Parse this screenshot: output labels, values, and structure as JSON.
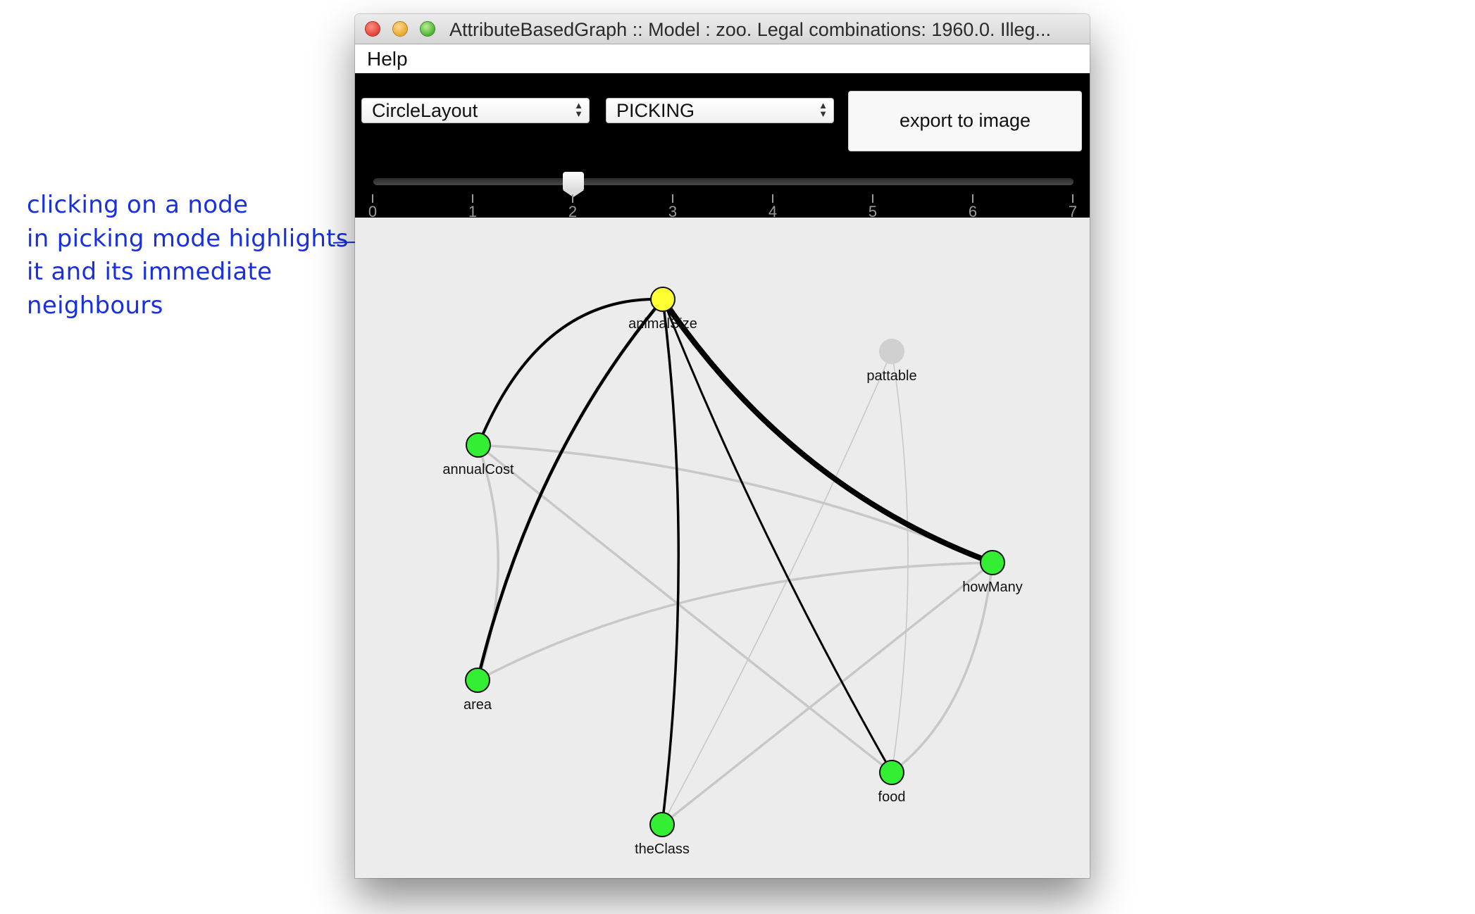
{
  "annotation": {
    "lines": [
      "clicking on a node",
      "in picking mode highlights",
      "it and its immediate",
      "neighbours"
    ]
  },
  "window": {
    "title": "AttributeBasedGraph :: Model : zoo. Legal combinations: 1960.0. Illeg...",
    "menu": [
      "Help"
    ]
  },
  "toolbar": {
    "layout_select": "CircleLayout",
    "mode_select": "PICKING",
    "export_label": "export to image",
    "slider": {
      "min": 0,
      "max": 7,
      "value": 2,
      "ticks": [
        "0",
        "1",
        "2",
        "3",
        "4",
        "5",
        "6",
        "7"
      ]
    }
  },
  "graph": {
    "selected_node": "animalSize",
    "colors": {
      "selected": "#ffff33",
      "neighbour": "#33ee33",
      "inactive": "#d0d0d0",
      "highlight_edge": "#000000",
      "normal_edge": "#c8c8c8",
      "selected_label": "#1838e8"
    },
    "nodes": [
      {
        "id": "animalSize",
        "label": "animalSize",
        "state": "selected"
      },
      {
        "id": "pattable",
        "label": "pattable",
        "state": "inactive"
      },
      {
        "id": "annualCost",
        "label": "annualCost",
        "state": "neighbour"
      },
      {
        "id": "howMany",
        "label": "howMany",
        "state": "neighbour"
      },
      {
        "id": "area",
        "label": "area",
        "state": "neighbour"
      },
      {
        "id": "food",
        "label": "food",
        "state": "neighbour"
      },
      {
        "id": "theClass",
        "label": "theClass",
        "state": "neighbour"
      }
    ],
    "edges": [
      {
        "from": "animalSize",
        "to": "annualCost",
        "highlighted": true
      },
      {
        "from": "animalSize",
        "to": "area",
        "highlighted": true
      },
      {
        "from": "animalSize",
        "to": "theClass",
        "highlighted": true
      },
      {
        "from": "animalSize",
        "to": "food",
        "highlighted": true
      },
      {
        "from": "animalSize",
        "to": "howMany",
        "highlighted": true
      },
      {
        "from": "annualCost",
        "to": "howMany",
        "highlighted": false
      },
      {
        "from": "annualCost",
        "to": "food",
        "highlighted": false
      },
      {
        "from": "annualCost",
        "to": "area",
        "highlighted": false
      },
      {
        "from": "area",
        "to": "howMany",
        "highlighted": false
      },
      {
        "from": "pattable",
        "to": "theClass",
        "highlighted": false
      },
      {
        "from": "pattable",
        "to": "food",
        "highlighted": false
      },
      {
        "from": "howMany",
        "to": "food",
        "highlighted": false
      },
      {
        "from": "howMany",
        "to": "theClass",
        "highlighted": false
      }
    ]
  }
}
